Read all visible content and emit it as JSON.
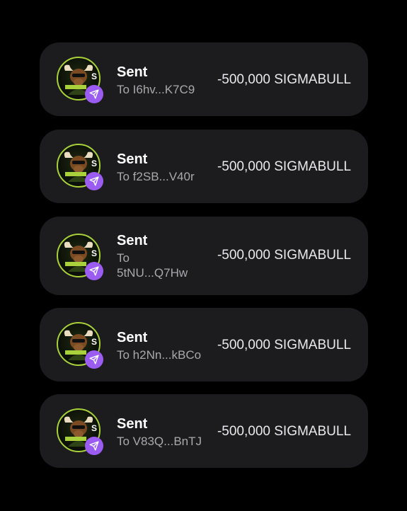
{
  "transactions": [
    {
      "status": "Sent",
      "recipient": "To I6hv...K7C9",
      "amount": "-500,000 SIGMABULL",
      "token_icon": "sigmabull-logo-icon",
      "badge_icon": "send-arrow-icon"
    },
    {
      "status": "Sent",
      "recipient": "To f2SB...V40r",
      "amount": "-500,000 SIGMABULL",
      "token_icon": "sigmabull-logo-icon",
      "badge_icon": "send-arrow-icon"
    },
    {
      "status": "Sent",
      "recipient": "To 5tNU...Q7Hw",
      "amount": "-500,000 SIGMABULL",
      "token_icon": "sigmabull-logo-icon",
      "badge_icon": "send-arrow-icon"
    },
    {
      "status": "Sent",
      "recipient": "To h2Nn...kBCo",
      "amount": "-500,000 SIGMABULL",
      "token_icon": "sigmabull-logo-icon",
      "badge_icon": "send-arrow-icon"
    },
    {
      "status": "Sent",
      "recipient": "To V83Q...BnTJ",
      "amount": "-500,000 SIGMABULL",
      "token_icon": "sigmabull-logo-icon",
      "badge_icon": "send-arrow-icon"
    }
  ],
  "colors": {
    "background": "#000000",
    "card": "#1c1c1e",
    "badge": "#9b5cf2",
    "logo_accent": "#a9d13b",
    "title": "#ffffff",
    "subtitle": "#a8a8ad"
  }
}
